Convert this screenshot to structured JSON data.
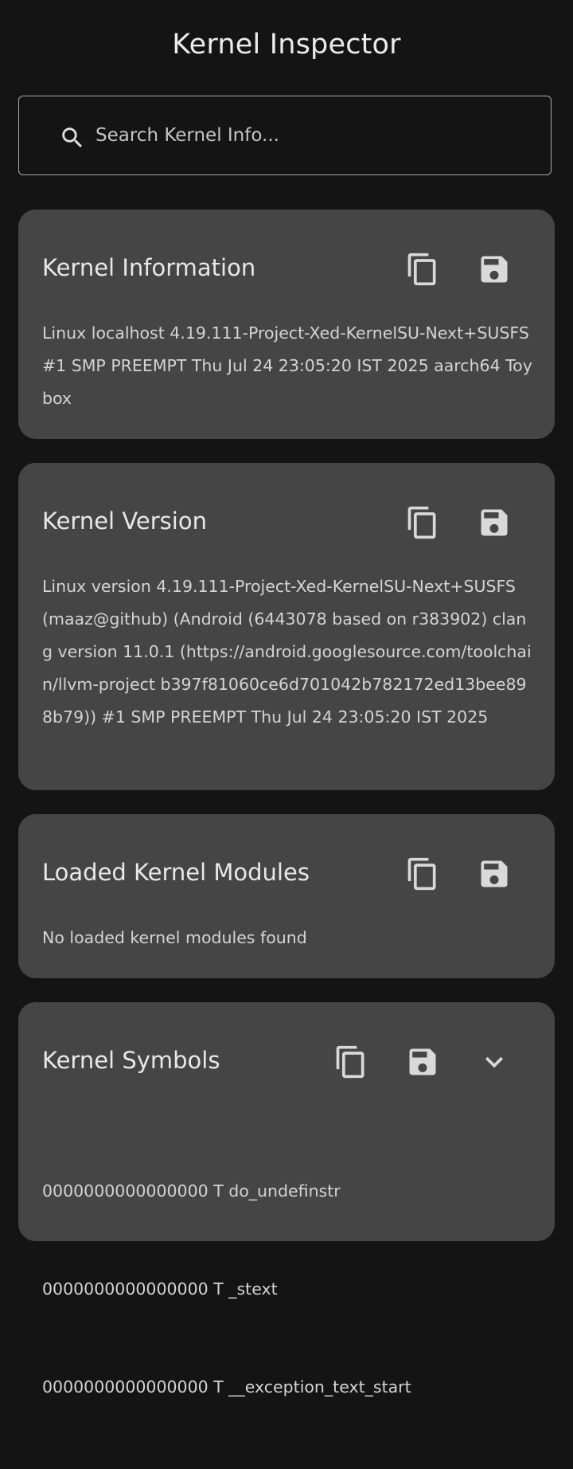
{
  "app": {
    "title": "Kernel Inspector"
  },
  "search": {
    "placeholder": "Search Kernel Info...",
    "value": ""
  },
  "cards": {
    "info": {
      "title": "Kernel Information",
      "body": "Linux localhost 4.19.111-Project-Xed-KernelSU-Next+SUSFS #1 SMP PREEMPT Thu Jul 24 23:05:20 IST 2025 aarch64 Toybox"
    },
    "version": {
      "title": "Kernel Version",
      "body": "Linux version 4.19.111-Project-Xed-KernelSU-Next+SUSFS (maaz@github) (Android (6443078 based on r383902) clang version 11.0.1 (https://android.googlesource.com/toolchain/llvm-project b397f81060ce6d701042b782172ed13bee898b79)) #1 SMP PREEMPT Thu Jul 24 23:05:20 IST 2025"
    },
    "modules": {
      "title": "Loaded Kernel Modules",
      "body": "No loaded kernel modules found"
    },
    "symbols": {
      "title": "Kernel Symbols",
      "lines": [
        "0000000000000000 T do_undefinstr",
        "0000000000000000 T _stext",
        "0000000000000000 T __exception_text_start"
      ]
    }
  },
  "icons": {
    "copy": "copy-icon",
    "save": "save-icon",
    "expand": "chevron-down-icon",
    "search": "search-icon"
  },
  "colors": {
    "background": "#141414",
    "card": "#454545",
    "icon": "#d9d9d9",
    "text": "#d4d4d4"
  }
}
